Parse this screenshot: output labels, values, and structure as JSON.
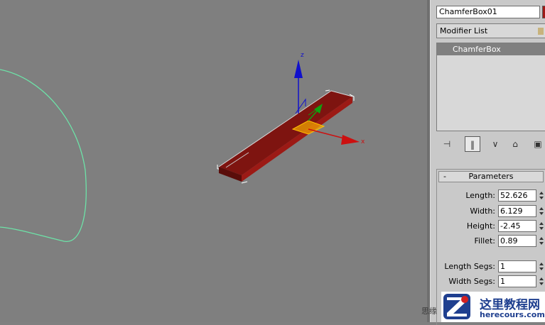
{
  "viewport": {
    "axes": {
      "z": "z",
      "x": "x"
    },
    "colors": {
      "object": "#8c1512",
      "spline": "#6de3a8",
      "axis_x": "#cc1010",
      "axis_z": "#1010cc",
      "axis_y": "#10a010",
      "gizmo_plane": "#f0a000"
    }
  },
  "panel": {
    "object_name": "ChamferBox01",
    "swatch_color": "#a01a16",
    "modifier_list_label": "Modifier List",
    "stack_items": [
      "ChamferBox"
    ],
    "toolbar": [
      {
        "icon": "pin-stack-icon",
        "glyph": "⊣"
      },
      {
        "icon": "show-end-result-icon",
        "glyph": "‖"
      },
      {
        "icon": "make-unique-icon",
        "glyph": "∨"
      },
      {
        "icon": "remove-modifier-icon",
        "glyph": "⌂"
      },
      {
        "icon": "configure-modifier-sets-icon",
        "glyph": "▣"
      }
    ],
    "rollout_title": "Parameters",
    "rollout_toggle": "-",
    "params": [
      {
        "label": "Length:",
        "value": "52.626"
      },
      {
        "label": "Width:",
        "value": "6.129"
      },
      {
        "label": "Height:",
        "value": "-2.45"
      },
      {
        "label": "Fillet:",
        "value": "0.89"
      },
      {
        "label": "Length Segs:",
        "value": "1"
      },
      {
        "label": "Width Segs:",
        "value": "1"
      }
    ]
  },
  "watermark": {
    "cn": "这里教程网",
    "url": "herecours.com",
    "side": "思缘"
  }
}
